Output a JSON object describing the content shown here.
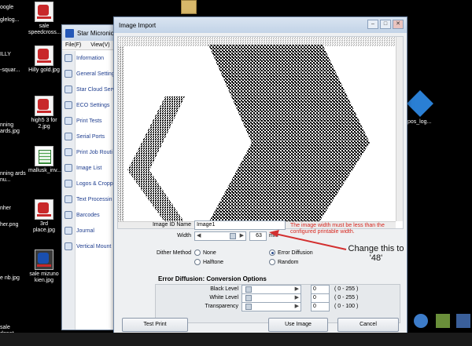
{
  "desktop": {
    "icons": [
      {
        "label": "sale speedcross...",
        "type": "photo"
      },
      {
        "label": "Hilly gold.jpg",
        "type": "photo"
      },
      {
        "label": "high5 3 for 2.jpg",
        "type": "photo"
      },
      {
        "label": "mallusk_inv...",
        "type": "sheet"
      },
      {
        "label": "3rd place.jpg",
        "type": "photo"
      },
      {
        "label": "sale mizuno kien.jpg",
        "type": "photo"
      }
    ],
    "cut_labels": [
      "glelog...",
      "-squar...",
      "nning ards.jpg",
      "nning ards nu...",
      "her.png",
      "e nb.jpg",
      "sale dgoat..."
    ],
    "logo_fragments": [
      "oogle",
      "ILLY",
      "nher"
    ],
    "right_icon_label": "pos_log..."
  },
  "app": {
    "title": "Star Micronics",
    "menu": [
      "File(F)",
      "View(V)"
    ],
    "nav": [
      {
        "label": "Information"
      },
      {
        "label": "General Setting"
      },
      {
        "label": "Star Cloud Serv"
      },
      {
        "label": "ECO Settings"
      },
      {
        "label": "Print Tests"
      },
      {
        "label": "Serial Ports"
      },
      {
        "label": "Print Job Routi"
      },
      {
        "label": "Image List"
      },
      {
        "label": "Logos & Cropp"
      },
      {
        "label": "Text Processin"
      },
      {
        "label": "Barcodes"
      },
      {
        "label": "Journal"
      },
      {
        "label": "Vertical Mount"
      }
    ]
  },
  "dialog": {
    "title": "Image Import",
    "image_id_label": "Image ID Name",
    "image_id_value": "Image1",
    "warning": "The image width must be less than the configured printable width.",
    "width_label": "Width",
    "width_value": "63",
    "width_unit": "mm",
    "dither_label": "Dither Method",
    "dither_options": {
      "none": "None",
      "halftone": "Halftone",
      "error_diffusion": "Error Diffusion",
      "random": "Random"
    },
    "dither_selected": "Error Diffusion",
    "ed_title": "Error Diffusion: Conversion Options",
    "ed_rows": [
      {
        "label": "Black Level",
        "value": "0",
        "range": "( 0 - 255 )"
      },
      {
        "label": "White Level",
        "value": "0",
        "range": "( 0 - 255 )"
      },
      {
        "label": "Transparency",
        "value": "0",
        "range": "( 0 - 100 )"
      }
    ],
    "buttons": {
      "test_print": "Test Print",
      "use_image": "Use Image",
      "cancel": "Cancel"
    }
  },
  "annotation": {
    "text": "Change this to '48'",
    "color": "#d32f2f"
  }
}
